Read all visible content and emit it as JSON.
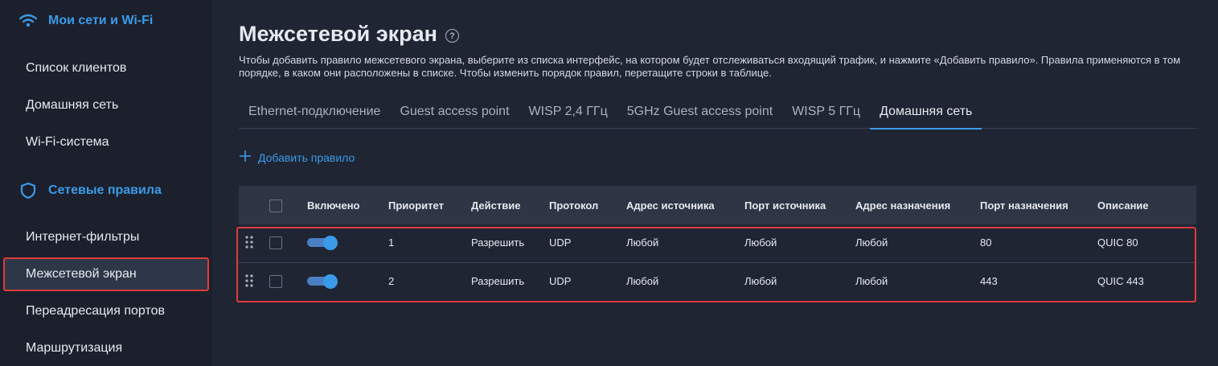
{
  "sidebar": {
    "groups": [
      {
        "label": "Мои сети и Wi-Fi",
        "icon": "wifi-icon"
      },
      {
        "label": "Сетевые правила",
        "icon": "shield-icon"
      }
    ],
    "items": [
      {
        "label": "Список клиентов"
      },
      {
        "label": "Домашняя сеть"
      },
      {
        "label": "Wi-Fi-система"
      },
      {
        "label": "Интернет-фильтры"
      },
      {
        "label": "Межсетевой экран",
        "active": true
      },
      {
        "label": "Переадресация портов"
      },
      {
        "label": "Маршрутизация"
      }
    ]
  },
  "main": {
    "title": "Межсетевой экран",
    "description": "Чтобы добавить правило межсетевого экрана, выберите из списка интерфейс, на котором будет отслеживаться входящий трафик, и нажмите «Добавить правило». Правила применяются в том порядке, в каком они расположены в списке. Чтобы изменить порядок правил, перетащите строки в таблице.",
    "tabs": [
      {
        "label": "Ethernet-подключение"
      },
      {
        "label": "Guest access point"
      },
      {
        "label": "WISP 2,4 ГГц"
      },
      {
        "label": "5GHz Guest access point"
      },
      {
        "label": "WISP 5 ГГц"
      },
      {
        "label": "Домашняя сеть",
        "active": true
      }
    ],
    "add_rule_label": "Добавить правило",
    "table": {
      "headers": {
        "enabled": "Включено",
        "priority": "Приоритет",
        "action": "Действие",
        "protocol": "Протокол",
        "src_addr": "Адрес источника",
        "src_port": "Порт источника",
        "dst_addr": "Адрес назначения",
        "dst_port": "Порт назначения",
        "description": "Описание"
      },
      "rows": [
        {
          "enabled": true,
          "priority": "1",
          "action": "Разрешить",
          "protocol": "UDP",
          "src_addr": "Любой",
          "src_port": "Любой",
          "dst_addr": "Любой",
          "dst_port": "80",
          "description": "QUIC 80"
        },
        {
          "enabled": true,
          "priority": "2",
          "action": "Разрешить",
          "protocol": "UDP",
          "src_addr": "Любой",
          "src_port": "Любой",
          "dst_addr": "Любой",
          "dst_port": "443",
          "description": "QUIC 443"
        }
      ]
    }
  },
  "colors": {
    "accent": "#3a9be8",
    "highlight": "#e03b3b",
    "background": "#1f2533",
    "sidebar_background": "#1b202c"
  }
}
